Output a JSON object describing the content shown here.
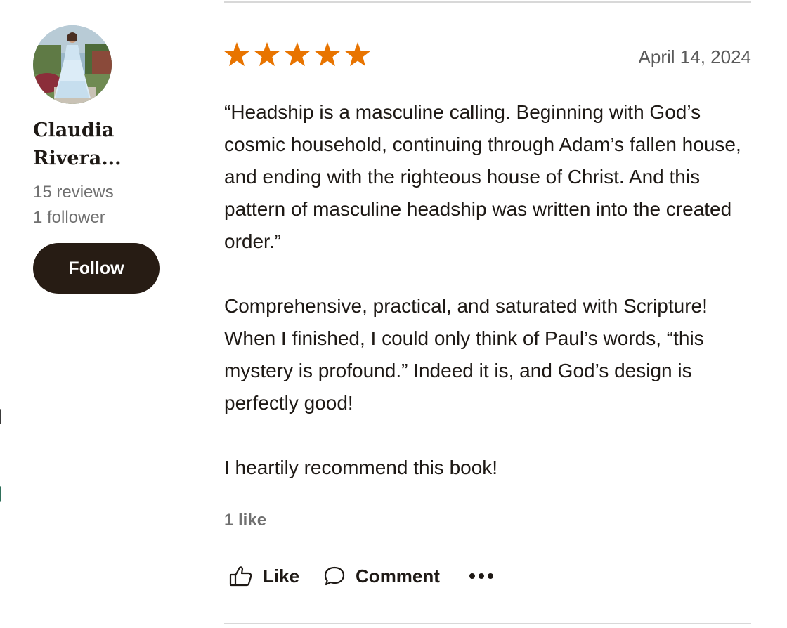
{
  "reviewer": {
    "name": "Claudia Rivera...",
    "reviews": "15 reviews",
    "followers": "1 follower",
    "follow_label": "Follow"
  },
  "review": {
    "rating": 5,
    "date": "April 14, 2024",
    "paragraphs": [
      "“Headship is a masculine calling. Beginning with God’s cosmic household, continuing through Adam’s fallen house, and ending with the righteous house of Christ. And this pattern of masculine headship was written into the created order.”",
      "Comprehensive, practical, and saturated with Scripture! When I finished, I could only think of Paul’s words, “this mystery is profound.” Indeed it is, and God’s design is perfectly good!",
      "I heartily recommend this book!"
    ],
    "like_count": "1 like"
  },
  "actions": {
    "like_label": "Like",
    "comment_label": "Comment"
  },
  "colors": {
    "star": "#e87400",
    "follow_button": "#271c14",
    "muted_text": "#707070"
  }
}
